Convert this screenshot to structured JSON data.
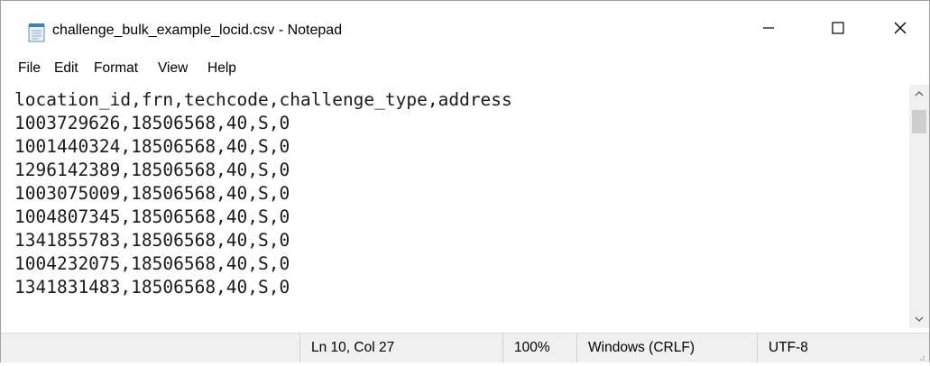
{
  "window": {
    "title": "challenge_bulk_example_locid.csv - Notepad",
    "icon": "notepad-icon",
    "controls": {
      "minimize_icon": "minimize-icon",
      "maximize_icon": "maximize-icon",
      "close_icon": "close-icon"
    }
  },
  "menu": {
    "items": [
      {
        "label": "File"
      },
      {
        "label": "Edit"
      },
      {
        "label": "Format"
      },
      {
        "label": "View"
      },
      {
        "label": "Help"
      }
    ]
  },
  "editor": {
    "lines": [
      "location_id,frn,techcode,challenge_type,address",
      "1003729626,18506568,40,S,0",
      "1001440324,18506568,40,S,0",
      "1296142389,18506568,40,S,0",
      "1003075009,18506568,40,S,0",
      "1004807345,18506568,40,S,0",
      "1341855783,18506568,40,S,0",
      "1004232075,18506568,40,S,0",
      "1341831483,18506568,40,S,0"
    ]
  },
  "statusbar": {
    "position": "Ln 10, Col 27",
    "zoom": "100%",
    "line_ending": "Windows (CRLF)",
    "encoding": "UTF-8"
  },
  "colors": {
    "statusbar_bg": "#f0f0f0",
    "scrollbar_thumb": "#cdcdcd"
  }
}
